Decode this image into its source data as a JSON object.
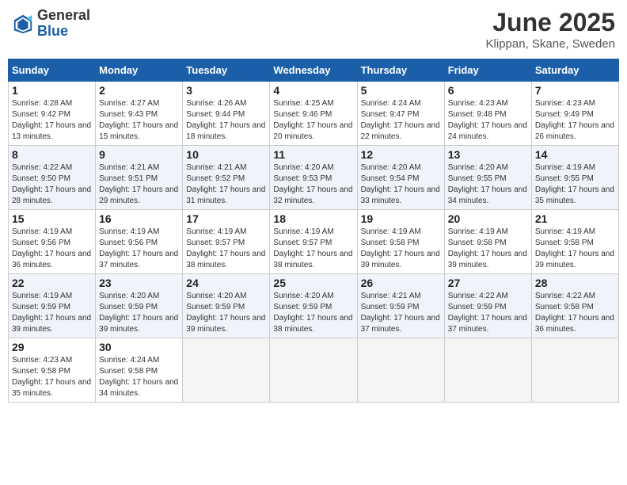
{
  "logo": {
    "general": "General",
    "blue": "Blue"
  },
  "header": {
    "month_year": "June 2025",
    "location": "Klippan, Skane, Sweden"
  },
  "days_of_week": [
    "Sunday",
    "Monday",
    "Tuesday",
    "Wednesday",
    "Thursday",
    "Friday",
    "Saturday"
  ],
  "weeks": [
    [
      {
        "day": "1",
        "sunrise": "4:28 AM",
        "sunset": "9:42 PM",
        "daylight": "17 hours and 13 minutes."
      },
      {
        "day": "2",
        "sunrise": "4:27 AM",
        "sunset": "9:43 PM",
        "daylight": "17 hours and 15 minutes."
      },
      {
        "day": "3",
        "sunrise": "4:26 AM",
        "sunset": "9:44 PM",
        "daylight": "17 hours and 18 minutes."
      },
      {
        "day": "4",
        "sunrise": "4:25 AM",
        "sunset": "9:46 PM",
        "daylight": "17 hours and 20 minutes."
      },
      {
        "day": "5",
        "sunrise": "4:24 AM",
        "sunset": "9:47 PM",
        "daylight": "17 hours and 22 minutes."
      },
      {
        "day": "6",
        "sunrise": "4:23 AM",
        "sunset": "9:48 PM",
        "daylight": "17 hours and 24 minutes."
      },
      {
        "day": "7",
        "sunrise": "4:23 AM",
        "sunset": "9:49 PM",
        "daylight": "17 hours and 26 minutes."
      }
    ],
    [
      {
        "day": "8",
        "sunrise": "4:22 AM",
        "sunset": "9:50 PM",
        "daylight": "17 hours and 28 minutes."
      },
      {
        "day": "9",
        "sunrise": "4:21 AM",
        "sunset": "9:51 PM",
        "daylight": "17 hours and 29 minutes."
      },
      {
        "day": "10",
        "sunrise": "4:21 AM",
        "sunset": "9:52 PM",
        "daylight": "17 hours and 31 minutes."
      },
      {
        "day": "11",
        "sunrise": "4:20 AM",
        "sunset": "9:53 PM",
        "daylight": "17 hours and 32 minutes."
      },
      {
        "day": "12",
        "sunrise": "4:20 AM",
        "sunset": "9:54 PM",
        "daylight": "17 hours and 33 minutes."
      },
      {
        "day": "13",
        "sunrise": "4:20 AM",
        "sunset": "9:55 PM",
        "daylight": "17 hours and 34 minutes."
      },
      {
        "day": "14",
        "sunrise": "4:19 AM",
        "sunset": "9:55 PM",
        "daylight": "17 hours and 35 minutes."
      }
    ],
    [
      {
        "day": "15",
        "sunrise": "4:19 AM",
        "sunset": "9:56 PM",
        "daylight": "17 hours and 36 minutes."
      },
      {
        "day": "16",
        "sunrise": "4:19 AM",
        "sunset": "9:56 PM",
        "daylight": "17 hours and 37 minutes."
      },
      {
        "day": "17",
        "sunrise": "4:19 AM",
        "sunset": "9:57 PM",
        "daylight": "17 hours and 38 minutes."
      },
      {
        "day": "18",
        "sunrise": "4:19 AM",
        "sunset": "9:57 PM",
        "daylight": "17 hours and 38 minutes."
      },
      {
        "day": "19",
        "sunrise": "4:19 AM",
        "sunset": "9:58 PM",
        "daylight": "17 hours and 39 minutes."
      },
      {
        "day": "20",
        "sunrise": "4:19 AM",
        "sunset": "9:58 PM",
        "daylight": "17 hours and 39 minutes."
      },
      {
        "day": "21",
        "sunrise": "4:19 AM",
        "sunset": "9:58 PM",
        "daylight": "17 hours and 39 minutes."
      }
    ],
    [
      {
        "day": "22",
        "sunrise": "4:19 AM",
        "sunset": "9:59 PM",
        "daylight": "17 hours and 39 minutes."
      },
      {
        "day": "23",
        "sunrise": "4:20 AM",
        "sunset": "9:59 PM",
        "daylight": "17 hours and 39 minutes."
      },
      {
        "day": "24",
        "sunrise": "4:20 AM",
        "sunset": "9:59 PM",
        "daylight": "17 hours and 39 minutes."
      },
      {
        "day": "25",
        "sunrise": "4:20 AM",
        "sunset": "9:59 PM",
        "daylight": "17 hours and 38 minutes."
      },
      {
        "day": "26",
        "sunrise": "4:21 AM",
        "sunset": "9:59 PM",
        "daylight": "17 hours and 37 minutes."
      },
      {
        "day": "27",
        "sunrise": "4:22 AM",
        "sunset": "9:59 PM",
        "daylight": "17 hours and 37 minutes."
      },
      {
        "day": "28",
        "sunrise": "4:22 AM",
        "sunset": "9:58 PM",
        "daylight": "17 hours and 36 minutes."
      }
    ],
    [
      {
        "day": "29",
        "sunrise": "4:23 AM",
        "sunset": "9:58 PM",
        "daylight": "17 hours and 35 minutes."
      },
      {
        "day": "30",
        "sunrise": "4:24 AM",
        "sunset": "9:58 PM",
        "daylight": "17 hours and 34 minutes."
      },
      null,
      null,
      null,
      null,
      null
    ]
  ]
}
